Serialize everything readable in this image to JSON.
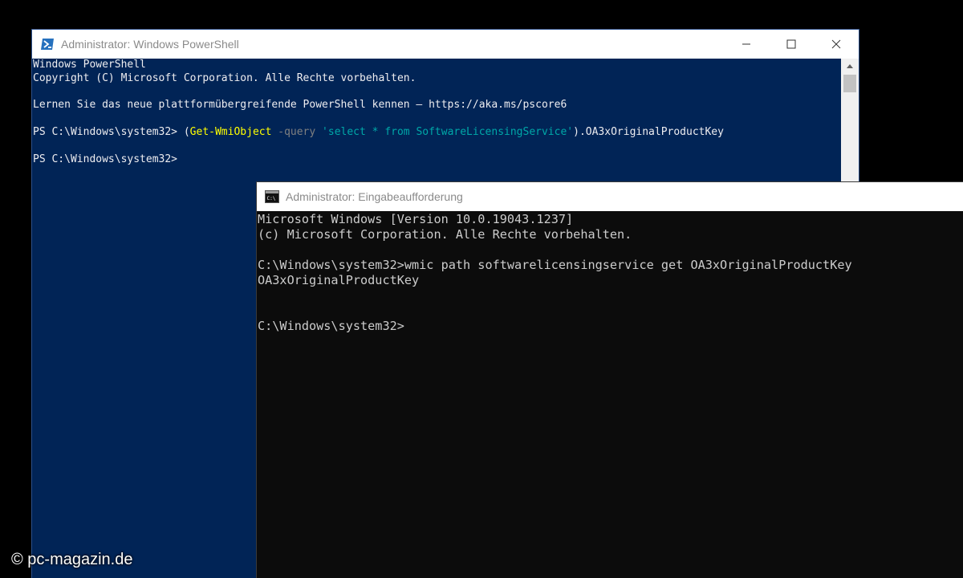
{
  "powershell": {
    "title": "Administrator: Windows PowerShell",
    "colors": {
      "background": "#012456",
      "text": "#eeedf0",
      "cmdlet": "#ffff00",
      "parameter": "#808080",
      "string": "#00a8a8"
    },
    "lines": {
      "l1": "Windows PowerShell",
      "l2": "Copyright (C) Microsoft Corporation. Alle Rechte vorbehalten.",
      "l4": "Lernen Sie das neue plattformübergreifende PowerShell kennen – https://aka.ms/pscore6"
    },
    "command": {
      "prompt": "PS C:\\Windows\\system32> ",
      "open_paren": "(",
      "cmdlet": "Get-WmiObject",
      "param": " -query ",
      "query": "'select * from SoftwareLicensingService'",
      "tail": ").OA3xOriginalProductKey"
    },
    "prompt2": "PS C:\\Windows\\system32>",
    "icons": {
      "app": "powershell-icon",
      "minimize": "minimize-icon",
      "maximize": "maximize-icon",
      "close": "close-icon"
    }
  },
  "cmd": {
    "title": "Administrator: Eingabeaufforderung",
    "colors": {
      "background": "#0c0c0c",
      "text": "#cccccc"
    },
    "lines": {
      "l1": "Microsoft Windows [Version 10.0.19043.1237]",
      "l2": "(c) Microsoft Corporation. Alle Rechte vorbehalten.",
      "l4": "C:\\Windows\\system32>wmic path softwarelicensingservice get OA3xOriginalProductKey",
      "l5": "OA3xOriginalProductKey",
      "l8": "C:\\Windows\\system32>"
    },
    "icons": {
      "app": "cmd-icon"
    }
  },
  "watermark": "© pc-magazin.de"
}
